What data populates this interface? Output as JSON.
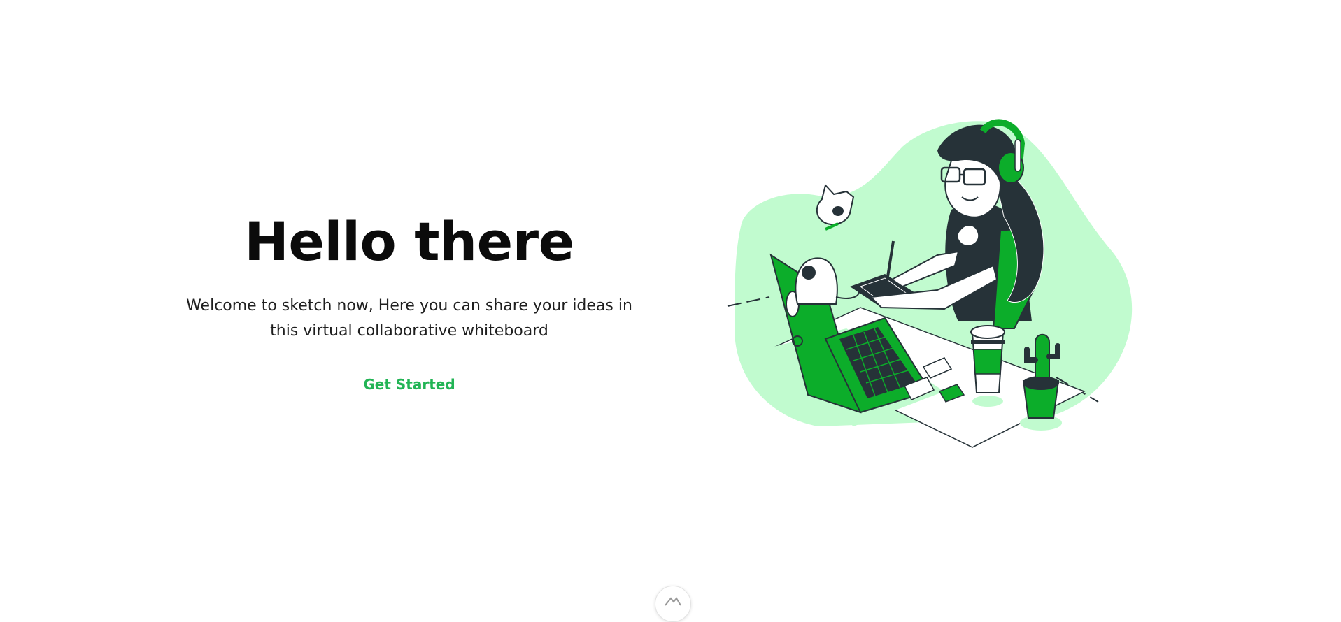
{
  "hero": {
    "title": "Hello there",
    "subtitle": "Welcome to sketch now, Here you can share your ideas in this virtual collaborative whiteboard",
    "cta_label": "Get Started"
  },
  "illustration": {
    "icon": "woman-drawing-on-tablet-with-laptop-and-cat-illustration"
  },
  "scroll_indicator": {
    "icon": "chevron-up-icon"
  },
  "colors": {
    "accent": "#22b455",
    "illustration_green": "#0cad2a",
    "illustration_mint": "#c1fbcf",
    "illustration_dark": "#263238",
    "text": "#0b0b0b"
  }
}
